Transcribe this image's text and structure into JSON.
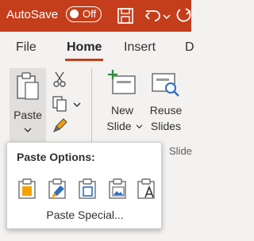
{
  "titlebar": {
    "autosave_label": "AutoSave",
    "toggle_state": "Off",
    "icons": [
      "save-icon",
      "undo-icon",
      "redo-icon"
    ],
    "accent": "#c43e1c"
  },
  "tabs": [
    {
      "label": "File",
      "active": false
    },
    {
      "label": "Home",
      "active": true
    },
    {
      "label": "Insert",
      "active": false
    },
    {
      "label": "D",
      "active": false
    }
  ],
  "ribbon": {
    "paste_label": "Paste",
    "new_slide": {
      "line1": "New",
      "line2": "Slide"
    },
    "reuse_slides": {
      "line1": "Reuse",
      "line2": "Slides"
    },
    "group_label": "Slide"
  },
  "paste_menu": {
    "title": "Paste Options:",
    "options": [
      "use-destination-theme-icon",
      "keep-source-formatting-icon",
      "embed-icon",
      "picture-icon",
      "keep-text-only-icon"
    ],
    "special_label": "Paste Special..."
  }
}
